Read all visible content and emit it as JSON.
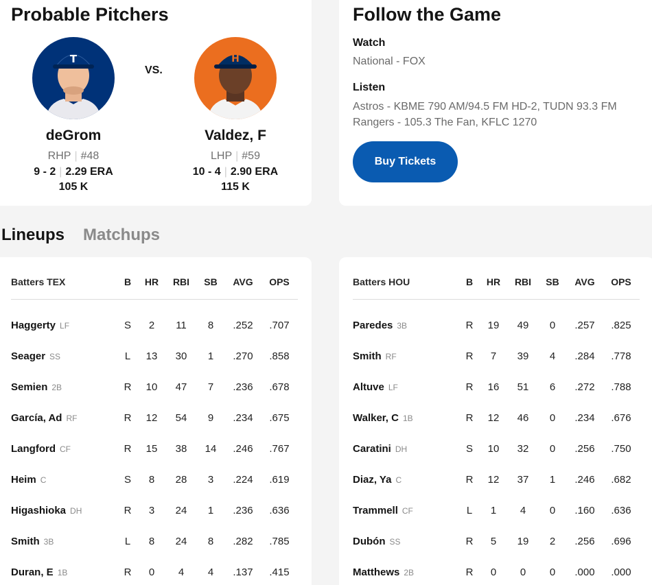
{
  "probable_pitchers": {
    "title": "Probable Pitchers",
    "vs_label": "VS.",
    "away": {
      "name": "deGrom",
      "hand": "RHP",
      "number": "#48",
      "record": "9 - 2",
      "era": "2.29 ERA",
      "strikeouts": "105 K",
      "cap_letter": "T"
    },
    "home": {
      "name": "Valdez, F",
      "hand": "LHP",
      "number": "#59",
      "record": "10 - 4",
      "era": "2.90 ERA",
      "strikeouts": "115 K",
      "cap_letter": "H"
    }
  },
  "follow": {
    "title": "Follow the Game",
    "watch_label": "Watch",
    "watch_value": "National - FOX",
    "listen_label": "Listen",
    "listen_lines": [
      "Astros - KBME 790 AM/94.5 FM HD-2, TUDN 93.3 FM",
      "Rangers - 105.3 The Fan, KFLC 1270"
    ],
    "button_label": "Buy Tickets"
  },
  "tabs": {
    "lineups": "Lineups",
    "matchups": "Matchups"
  },
  "columns": [
    "B",
    "HR",
    "RBI",
    "SB",
    "AVG",
    "OPS"
  ],
  "tex": {
    "header": "Batters TEX",
    "rows": [
      {
        "name": "Haggerty",
        "pos": "LF",
        "b": "S",
        "hr": "2",
        "rbi": "11",
        "sb": "8",
        "avg": ".252",
        "ops": ".707"
      },
      {
        "name": "Seager",
        "pos": "SS",
        "b": "L",
        "hr": "13",
        "rbi": "30",
        "sb": "1",
        "avg": ".270",
        "ops": ".858"
      },
      {
        "name": "Semien",
        "pos": "2B",
        "b": "R",
        "hr": "10",
        "rbi": "47",
        "sb": "7",
        "avg": ".236",
        "ops": ".678"
      },
      {
        "name": "García, Ad",
        "pos": "RF",
        "b": "R",
        "hr": "12",
        "rbi": "54",
        "sb": "9",
        "avg": ".234",
        "ops": ".675"
      },
      {
        "name": "Langford",
        "pos": "CF",
        "b": "R",
        "hr": "15",
        "rbi": "38",
        "sb": "14",
        "avg": ".246",
        "ops": ".767"
      },
      {
        "name": "Heim",
        "pos": "C",
        "b": "S",
        "hr": "8",
        "rbi": "28",
        "sb": "3",
        "avg": ".224",
        "ops": ".619"
      },
      {
        "name": "Higashioka",
        "pos": "DH",
        "b": "R",
        "hr": "3",
        "rbi": "24",
        "sb": "1",
        "avg": ".236",
        "ops": ".636"
      },
      {
        "name": "Smith",
        "pos": "3B",
        "b": "L",
        "hr": "8",
        "rbi": "24",
        "sb": "8",
        "avg": ".282",
        "ops": ".785"
      },
      {
        "name": "Duran, E",
        "pos": "1B",
        "b": "R",
        "hr": "0",
        "rbi": "4",
        "sb": "4",
        "avg": ".137",
        "ops": ".415"
      }
    ]
  },
  "hou": {
    "header": "Batters HOU",
    "rows": [
      {
        "name": "Paredes",
        "pos": "3B",
        "b": "R",
        "hr": "19",
        "rbi": "49",
        "sb": "0",
        "avg": ".257",
        "ops": ".825"
      },
      {
        "name": "Smith",
        "pos": "RF",
        "b": "R",
        "hr": "7",
        "rbi": "39",
        "sb": "4",
        "avg": ".284",
        "ops": ".778"
      },
      {
        "name": "Altuve",
        "pos": "LF",
        "b": "R",
        "hr": "16",
        "rbi": "51",
        "sb": "6",
        "avg": ".272",
        "ops": ".788"
      },
      {
        "name": "Walker, C",
        "pos": "1B",
        "b": "R",
        "hr": "12",
        "rbi": "46",
        "sb": "0",
        "avg": ".234",
        "ops": ".676"
      },
      {
        "name": "Caratini",
        "pos": "DH",
        "b": "S",
        "hr": "10",
        "rbi": "32",
        "sb": "0",
        "avg": ".256",
        "ops": ".750"
      },
      {
        "name": "Diaz, Ya",
        "pos": "C",
        "b": "R",
        "hr": "12",
        "rbi": "37",
        "sb": "1",
        "avg": ".246",
        "ops": ".682"
      },
      {
        "name": "Trammell",
        "pos": "CF",
        "b": "L",
        "hr": "1",
        "rbi": "4",
        "sb": "0",
        "avg": ".160",
        "ops": ".636"
      },
      {
        "name": "Dubón",
        "pos": "SS",
        "b": "R",
        "hr": "5",
        "rbi": "19",
        "sb": "2",
        "avg": ".256",
        "ops": ".696"
      },
      {
        "name": "Matthews",
        "pos": "2B",
        "b": "R",
        "hr": "0",
        "rbi": "0",
        "sb": "0",
        "avg": ".000",
        "ops": ".000"
      }
    ]
  },
  "colors": {
    "accent": "#0a5bb1",
    "rangers_blue": "#003278",
    "astros_orange": "#eb6e1f",
    "astros_navy": "#002d62"
  }
}
